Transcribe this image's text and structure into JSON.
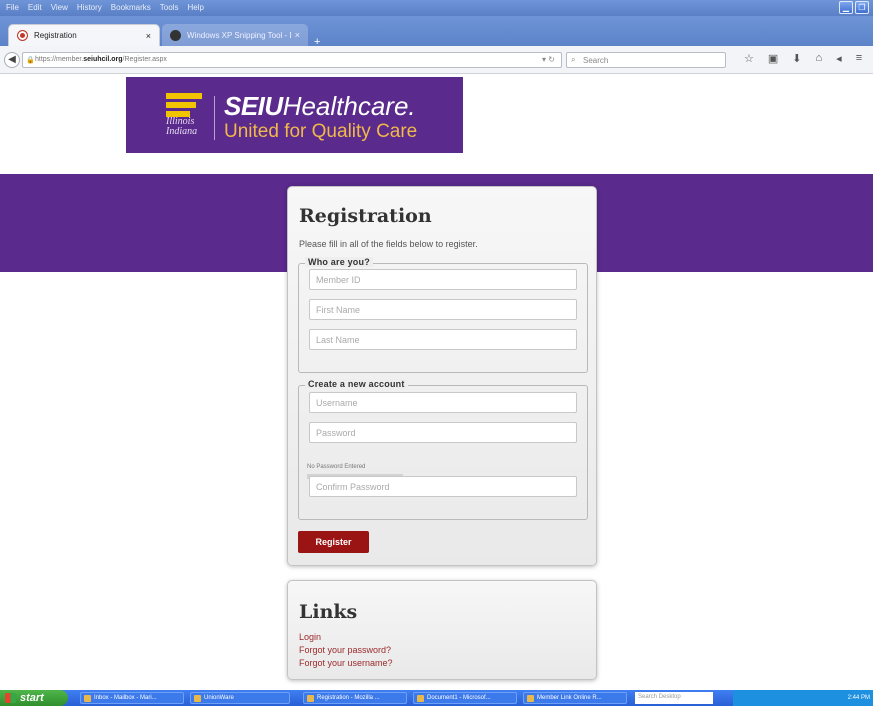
{
  "browser": {
    "menu": [
      "File",
      "Edit",
      "View",
      "History",
      "Bookmarks",
      "Tools",
      "Help"
    ],
    "tabs": [
      {
        "title": "Registration",
        "close": "×"
      },
      {
        "title": "Windows XP Snipping Tool - D...",
        "close": "×"
      }
    ],
    "new_tab": "+",
    "url_prefix": "https://member.",
    "url_domain": "seiuhcil.org",
    "url_path": "/Register.aspx",
    "search_placeholder": "Search"
  },
  "logo": {
    "state": "Illinois\nIndiana",
    "brand_bold": "SEIU",
    "brand_rest": "Healthcare.",
    "tagline": "United for Quality Care"
  },
  "registration": {
    "title": "Registration",
    "intro": "Please fill in all of the fields below to register.",
    "group1_legend": "Who are you?",
    "member_id_placeholder": "Member ID",
    "first_name_placeholder": "First Name",
    "last_name_placeholder": "Last Name",
    "group2_legend": "Create a new account",
    "username_placeholder": "Username",
    "password_placeholder": "Password",
    "password_strength": "No Password Entered",
    "confirm_password_placeholder": "Confirm Password",
    "register_label": "Register"
  },
  "links": {
    "title": "Links",
    "items": [
      "Login",
      "Forgot your password?",
      "Forgot your username?"
    ]
  },
  "taskbar": {
    "start": "start",
    "tasks": [
      "Inbox - Mailbox - Mari...",
      "UnionWare",
      "Registration - Mozilla ...",
      "Document1 - Microsof...",
      "Member Link Online R..."
    ],
    "search": "Search Desktop",
    "clock": "2:44 PM"
  },
  "colors": {
    "brand_purple": "#5a2a8c",
    "button_red": "#9b1414",
    "link_red": "#9b2a2a",
    "logo_gold": "#f2c400"
  }
}
